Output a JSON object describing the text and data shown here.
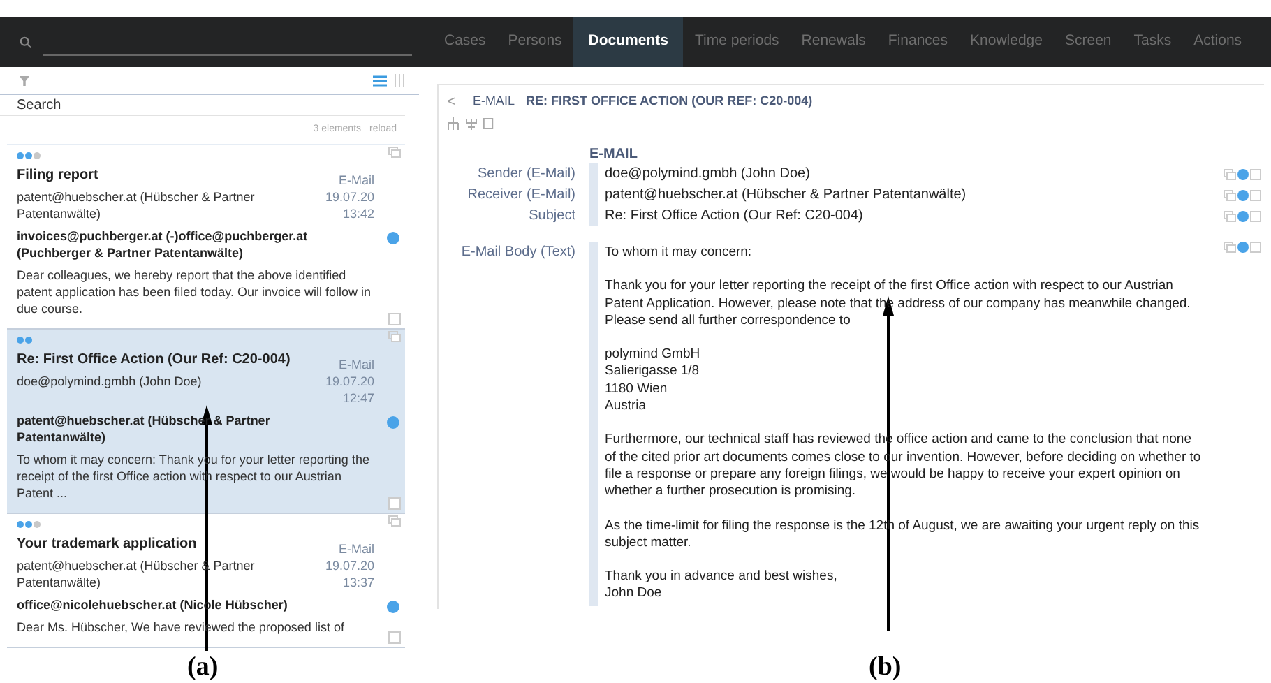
{
  "top_bar": {
    "tabs": [
      {
        "label": "Cases",
        "selected": false
      },
      {
        "label": "Persons",
        "selected": false
      },
      {
        "label": "Documents",
        "selected": true
      },
      {
        "label": "Time periods",
        "selected": false
      },
      {
        "label": "Renewals",
        "selected": false
      },
      {
        "label": "Finances",
        "selected": false
      },
      {
        "label": "Knowledge",
        "selected": false
      },
      {
        "label": "Screen",
        "selected": false
      },
      {
        "label": "Tasks",
        "selected": false
      },
      {
        "label": "Actions",
        "selected": false
      }
    ]
  },
  "list_panel": {
    "search_label": "Search",
    "count": "3 elements",
    "reload": "reload",
    "items": [
      {
        "selected": false,
        "checked": false,
        "dots": [
          {
            "color": "#4aa3e8"
          },
          {
            "color": "#4aa3e8"
          },
          {
            "color": "#c8c8c8"
          }
        ],
        "title": "Filing report",
        "sender": "patent@huebscher.at (Hübscher & Partner Patentanwälte)",
        "type": "E-Mail",
        "date": "19.07.20",
        "time": "13:42",
        "recipient": "invoices@puchberger.at (-)office@puchberger.at (Puchberger & Partner Patentanwälte)",
        "preview": "Dear colleagues, we hereby report that the above identified patent application has been filed today. Our invoice will follow in due course."
      },
      {
        "selected": true,
        "checked": false,
        "dots": [
          {
            "color": "#4aa3e8"
          },
          {
            "color": "#4aa3e8"
          }
        ],
        "title": "Re: First Office Action (Our Ref: C20-004)",
        "sender": "doe@polymind.gmbh (John Doe)",
        "type": "E-Mail",
        "date": "19.07.20",
        "time": "12:47",
        "recipient": "patent@huebscher.at (Hübscher & Partner Patentanwälte)",
        "preview": "To whom it may concern: Thank you for your letter reporting the receipt of the first Office action with respect to our Austrian Patent ..."
      },
      {
        "selected": false,
        "checked": false,
        "dots": [
          {
            "color": "#4aa3e8"
          },
          {
            "color": "#4aa3e8"
          },
          {
            "color": "#c8c8c8"
          }
        ],
        "title": "Your trademark application",
        "sender": "patent@huebscher.at (Hübscher & Partner Patentanwälte)",
        "type": "E-Mail",
        "date": "19.07.20",
        "time": "13:37",
        "recipient": "office@nicolehuebscher.at (Nicole Hübscher)",
        "preview": "Dear Ms. Hübscher, We have reviewed the proposed list of"
      }
    ]
  },
  "detail": {
    "back": "<",
    "kind_label": "E-MAIL",
    "title": "RE: FIRST OFFICE ACTION (OUR REF: C20-004)",
    "section": "E-MAIL",
    "fields": [
      {
        "label": "Sender (E-Mail)",
        "value": "doe@polymind.gmbh (John Doe)",
        "checked": false
      },
      {
        "label": "Receiver (E-Mail)",
        "value": "patent@huebscher.at (Hübscher & Partner Patentanwälte)",
        "checked": false
      },
      {
        "label": "Subject",
        "value": "Re: First Office Action (Our Ref: C20-004)",
        "checked": false
      }
    ],
    "body_label": "E-Mail Body (Text)",
    "body_checked": false,
    "body": [
      "To whom it may concern:",
      "Thank you for your letter reporting the receipt of the first Office action with respect to our Austrian Patent Application. However, please note that the address of our company has meanwhile changed. Please send all further correspondence to",
      [
        "polymind GmbH",
        "Salierigasse 1/8",
        "1180 Wien",
        "Austria"
      ],
      "Furthermore, our technical staff has reviewed the office action and came to the conclusion that none of the cited prior art documents comes close to our invention. However, before deciding on whether to file a response or prepare any foreign filings, we would be happy to receive your expert opinion on whether a further prosecution is promising.",
      "As the time-limit for filing the response is the 12th of August, we are awaiting your urgent reply on this subject matter.",
      [
        "Thank you in advance and best wishes,",
        "John Doe"
      ]
    ]
  },
  "annotations": [
    {
      "label": "(a)"
    },
    {
      "label": "(b)"
    }
  ]
}
